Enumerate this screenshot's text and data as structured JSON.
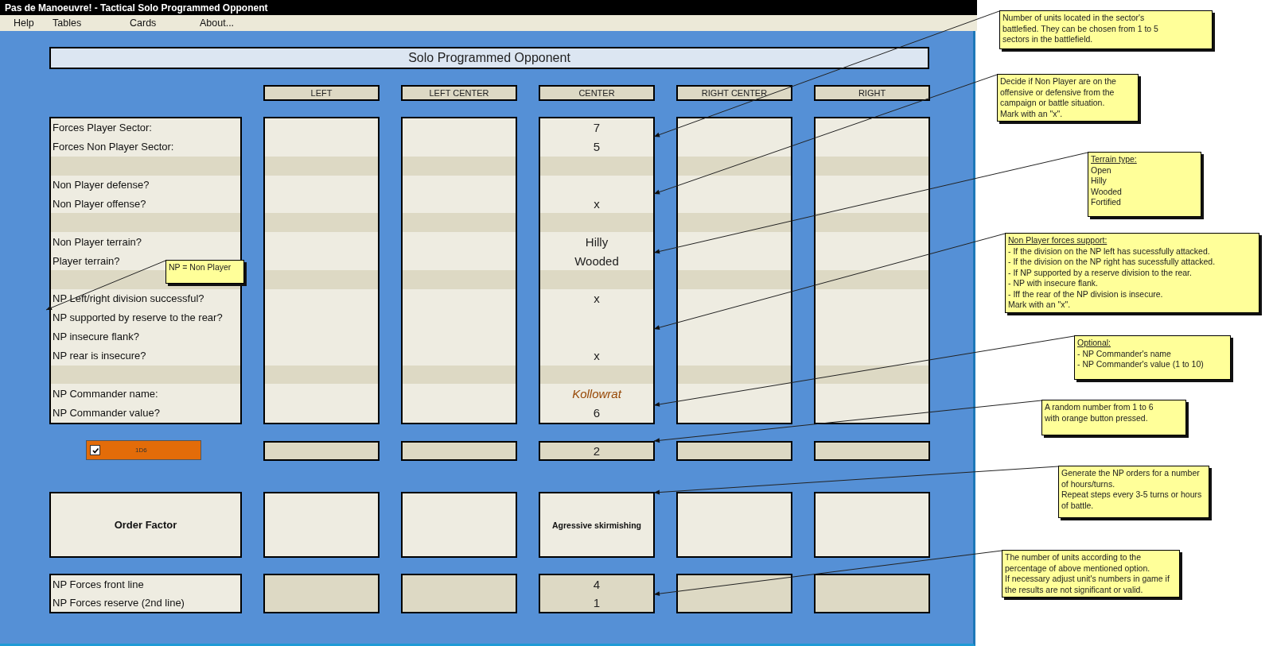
{
  "window": {
    "title": "Pas de Manoeuvre! - Tactical Solo Programmed Opponent"
  },
  "menu": [
    {
      "label": "Help"
    },
    {
      "label": "Tables"
    },
    {
      "label": "Cards"
    },
    {
      "label": "About..."
    }
  ],
  "sheet": {
    "title": "Solo Programmed Opponent",
    "columns": [
      {
        "label": "LEFT"
      },
      {
        "label": "LEFT CENTER"
      },
      {
        "label": "CENTER"
      },
      {
        "label": "RIGHT CENTER"
      },
      {
        "label": "RIGHT"
      }
    ],
    "rows": [
      {
        "kind": "field",
        "label": "Forces Player Sector:",
        "center": "7"
      },
      {
        "kind": "field",
        "label": "Forces Non Player Sector:",
        "center": "5"
      },
      {
        "kind": "gap"
      },
      {
        "kind": "field",
        "label": "Non Player defense?"
      },
      {
        "kind": "field",
        "label": "Non Player offense?",
        "center": "x"
      },
      {
        "kind": "gap"
      },
      {
        "kind": "field",
        "label": "Non Player terrain?",
        "center": "Hilly"
      },
      {
        "kind": "field",
        "label": "Player terrain?",
        "center": "Wooded"
      },
      {
        "kind": "gap"
      },
      {
        "kind": "field",
        "label": "NP Left/right division successful?",
        "center": "x"
      },
      {
        "kind": "field",
        "label": "NP supported by reserve to the rear?"
      },
      {
        "kind": "field",
        "label": "NP insecure flank?"
      },
      {
        "kind": "field",
        "label": "NP rear is insecure?",
        "center": "x"
      },
      {
        "kind": "gap"
      },
      {
        "kind": "name",
        "label": "NP Commander name:",
        "center": "Kollowrat"
      },
      {
        "kind": "field",
        "label": "NP Commander value?",
        "center": "6"
      }
    ],
    "dice_button": {
      "label": "1D6",
      "checked": true,
      "center": "2"
    },
    "order_factor": {
      "label": "Order Factor",
      "center": "Agressive skirmishing"
    },
    "forces_rows": [
      {
        "label": "NP Forces front line",
        "center": "4"
      },
      {
        "label": "NP Forces reserve (2nd line)",
        "center": "1"
      }
    ]
  },
  "notes": [
    {
      "lines": [
        "Number of units located in the sector's battlefied. They can be chosen from 1 to 5 sectors in the battlefield."
      ]
    },
    {
      "lines": [
        "Decide if Non Player are on the offensive or defensive from the campaign or battle situation.",
        "Mark with an \"x\"."
      ]
    },
    {
      "heading": "Terrain type:",
      "lines": [
        "Open",
        "Hilly",
        "Wooded",
        "Fortified"
      ]
    },
    {
      "heading": "Non Player forces support:",
      "lines": [
        "- If the division on the NP left has sucessfully attacked.",
        "- If the division on the NP right has sucessfully attacked.",
        "- If NP supported by a reserve division to the rear.",
        "- NP with insecure flank.",
        "- Iff the rear of the NP division is insecure.",
        "Mark with an \"x\"."
      ]
    },
    {
      "heading": "Optional:",
      "lines": [
        "- NP Commander's name",
        "- NP Commander's value (1 to 10)"
      ]
    },
    {
      "lines": [
        "A random number from 1 to 6",
        "with orange button pressed."
      ]
    },
    {
      "lines": [
        "Generate the NP orders for a number of hours/turns.",
        "Repeat steps every 3-5 turns or hours of battle."
      ]
    },
    {
      "lines": [
        "The number of units according to the percentage of above mentioned option.",
        "If necessary adjust unit's numbers in game if the results are not significant or valid."
      ]
    },
    {
      "lines": [
        "NP = Non Player"
      ]
    }
  ]
}
